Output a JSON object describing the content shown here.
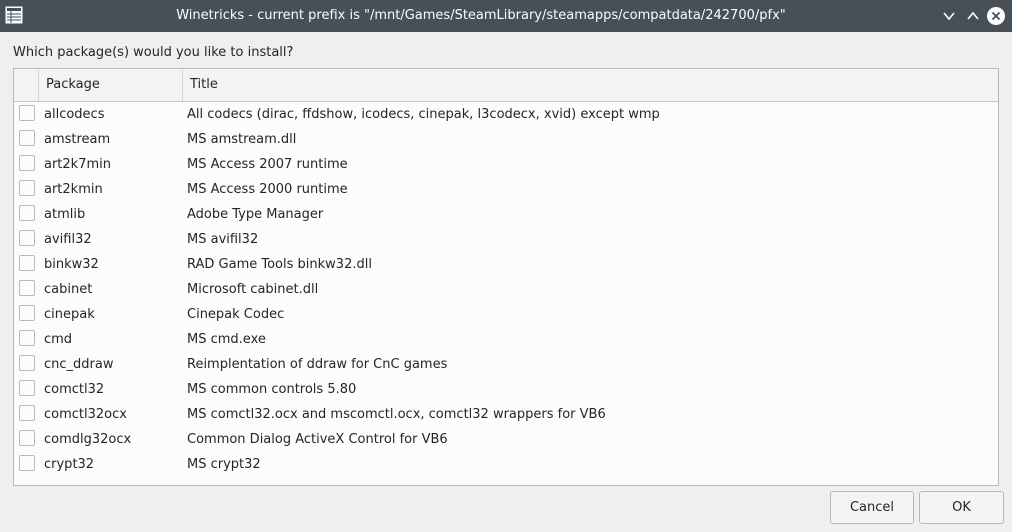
{
  "window": {
    "title": "Winetricks - current prefix is \"/mnt/Games/SteamLibrary/steamapps/compatdata/242700/pfx\"",
    "app_icon": "list-icon",
    "controls": [
      "chevron-down-icon",
      "chevron-up-icon",
      "close-icon"
    ]
  },
  "prompt": "Which package(s) would you like to install?",
  "table": {
    "headers": {
      "package": "Package",
      "title": "Title"
    },
    "rows": [
      {
        "package": "allcodecs",
        "title": "All codecs (dirac, ffdshow, icodecs, cinepak, l3codecx, xvid) except wmp",
        "checked": false
      },
      {
        "package": "amstream",
        "title": "MS amstream.dll",
        "checked": false
      },
      {
        "package": "art2k7min",
        "title": "MS Access 2007 runtime",
        "checked": false
      },
      {
        "package": "art2kmin",
        "title": "MS Access 2000 runtime",
        "checked": false
      },
      {
        "package": "atmlib",
        "title": "Adobe Type Manager",
        "checked": false
      },
      {
        "package": "avifil32",
        "title": "MS avifil32",
        "checked": false
      },
      {
        "package": "binkw32",
        "title": "RAD Game Tools binkw32.dll",
        "checked": false
      },
      {
        "package": "cabinet",
        "title": "Microsoft cabinet.dll",
        "checked": false
      },
      {
        "package": "cinepak",
        "title": "Cinepak Codec",
        "checked": false
      },
      {
        "package": "cmd",
        "title": "MS cmd.exe",
        "checked": false
      },
      {
        "package": "cnc_ddraw",
        "title": "Reimplentation of ddraw for CnC games",
        "checked": false
      },
      {
        "package": "comctl32",
        "title": "MS common controls 5.80",
        "checked": false
      },
      {
        "package": "comctl32ocx",
        "title": "MS comctl32.ocx and mscomctl.ocx, comctl32 wrappers for VB6",
        "checked": false
      },
      {
        "package": "comdlg32ocx",
        "title": "Common Dialog ActiveX Control for VB6",
        "checked": false
      },
      {
        "package": "crypt32",
        "title": "MS crypt32",
        "checked": false
      }
    ]
  },
  "buttons": {
    "cancel": "Cancel",
    "ok": "OK"
  },
  "colors": {
    "titlebar": "#475057",
    "background": "#efefef",
    "table_bg": "#fcfcfc"
  }
}
